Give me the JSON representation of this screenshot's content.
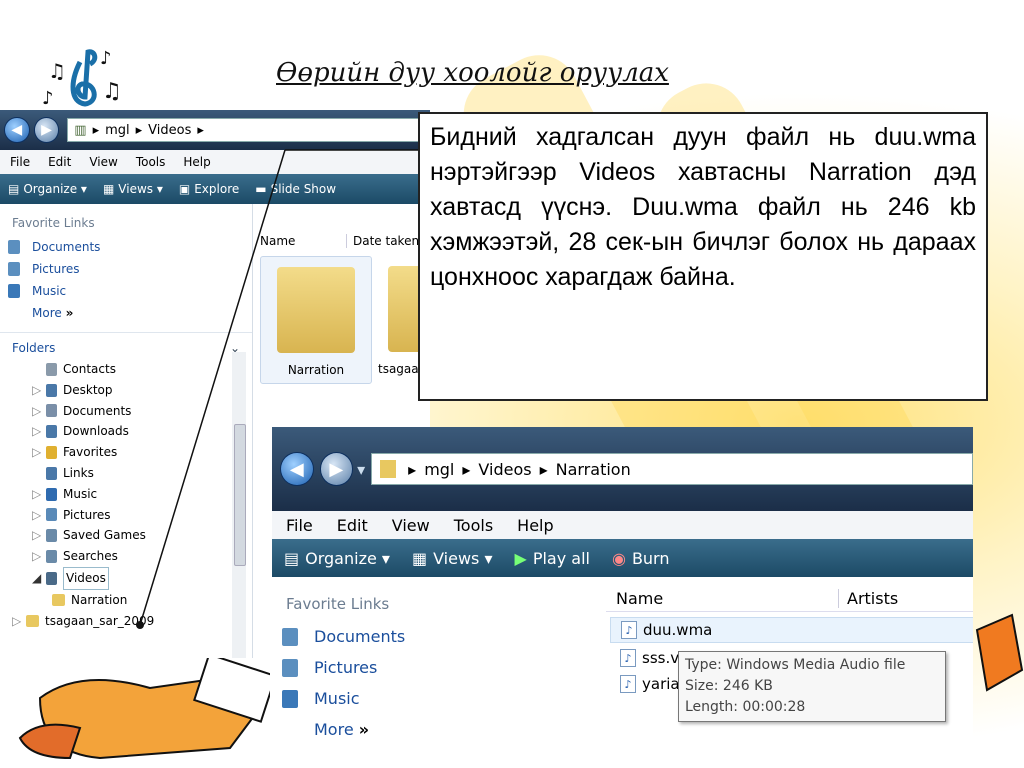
{
  "slide": {
    "title": "Өөрийн дуу хоолойг оруулах",
    "callout_text": "Бидний хадгалсан дуун файл нь duu.wma нэртэйгээр Videos хавтасны Narration дэд хавтасд үүснэ. Duu.wma файл нь 246 kb хэмжээтэй, 28 сек-ын бичлэг болох нь дараах цонхноос харагдаж байна."
  },
  "window1": {
    "breadcrumb": [
      "mgl",
      "Videos"
    ],
    "menu": [
      "File",
      "Edit",
      "View",
      "Tools",
      "Help"
    ],
    "toolbar": [
      "Organize",
      "Views",
      "Explore",
      "Slide Show"
    ],
    "favorite_links_header": "Favorite Links",
    "favorite_links": [
      "Documents",
      "Pictures",
      "Music"
    ],
    "more_label": "More",
    "folders_header": "Folders",
    "tree": [
      "Contacts",
      "Desktop",
      "Documents",
      "Downloads",
      "Favorites",
      "Links",
      "Music",
      "Pictures",
      "Saved Games",
      "Searches",
      "Videos",
      "Narration",
      "tsagaan_sar_2009"
    ],
    "columns": [
      "Name",
      "Date taken"
    ],
    "files": [
      "Narration",
      "tsagaa"
    ]
  },
  "window2": {
    "breadcrumb": [
      "mgl",
      "Videos",
      "Narration"
    ],
    "menu": [
      "File",
      "Edit",
      "View",
      "Tools",
      "Help"
    ],
    "toolbar": [
      "Organize",
      "Views",
      "Play all",
      "Burn"
    ],
    "favorite_links_header": "Favorite Links",
    "favorite_links": [
      "Documents",
      "Pictures",
      "Music"
    ],
    "more_label": "More",
    "columns": [
      "Name",
      "Artists"
    ],
    "files": [
      "duu.wma",
      "sss.v",
      "yaria"
    ],
    "tooltip": {
      "type": "Type: Windows Media Audio file",
      "size": "Size: 246 KB",
      "length": "Length: 00:00:28"
    }
  },
  "colors": {
    "nav_blue": "#1b5fb0",
    "toolbar": "#2a5d7d",
    "link": "#1a4e9c"
  }
}
